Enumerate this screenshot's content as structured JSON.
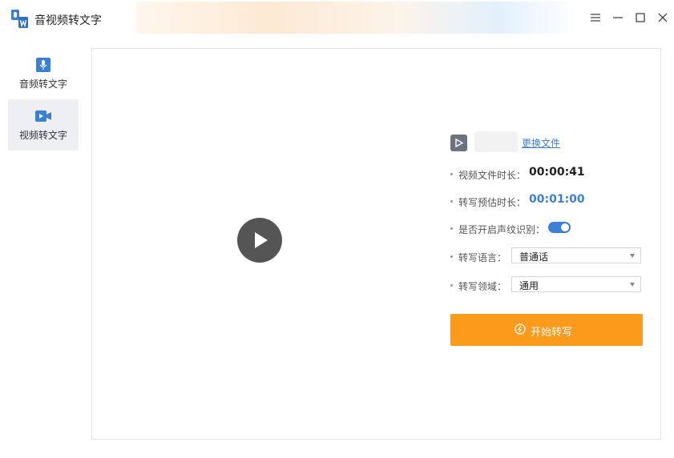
{
  "app": {
    "title": "音视频转文字"
  },
  "sidebar": {
    "items": [
      {
        "label": "音频转文字",
        "icon": "microphone-icon",
        "active": false
      },
      {
        "label": "视频转文字",
        "icon": "video-camera-icon",
        "active": true
      }
    ]
  },
  "window_controls": [
    "menu-icon",
    "minimize-icon",
    "maximize-icon",
    "close-icon"
  ],
  "file": {
    "change_label": "更换文件"
  },
  "info": {
    "duration_label": "视频文件时长：",
    "duration_value": "00:00:41",
    "estimate_label": "转写预估时长：",
    "estimate_value": "00:01:00",
    "voiceprint_label": "是否开启声纹识别：",
    "voiceprint_enabled": true,
    "language_label": "转写语言：",
    "language_value": "普通话",
    "domain_label": "转写领域：",
    "domain_value": "通用"
  },
  "actions": {
    "start_label": "开始转写"
  },
  "colors": {
    "accent_blue": "#3b7fd6",
    "start_orange": "#fb9a1b",
    "text_dark": "#222222"
  }
}
